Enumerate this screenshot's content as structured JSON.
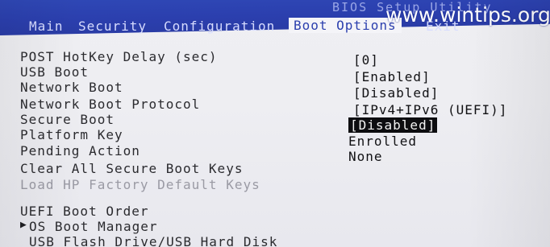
{
  "header": {
    "bios_title": "BIOS Setup Utility",
    "tabs": [
      {
        "label": "Main"
      },
      {
        "label": "Security"
      },
      {
        "label": "Configuration"
      },
      {
        "label": "Boot Options",
        "active": true
      },
      {
        "label": "Exit"
      }
    ],
    "watermark": "www.wintips.org"
  },
  "settings": [
    {
      "label": "POST HotKey Delay (sec)",
      "value": "[0]"
    },
    {
      "label": "USB Boot",
      "value": "[Enabled]"
    },
    {
      "label": "Network Boot",
      "value": "[Disabled]"
    },
    {
      "label": "Network Boot Protocol",
      "value": "[IPv4+IPv6 (UEFI)]"
    },
    {
      "label": "Secure Boot",
      "value": "[Disabled]",
      "selected": true
    },
    {
      "label": "Platform Key",
      "value": "Enrolled"
    },
    {
      "label": "Pending Action",
      "value": "None"
    },
    {
      "label": "Clear All Secure Boot Keys",
      "value": ""
    },
    {
      "label": "Load HP Factory Default Keys",
      "value": "",
      "disabled": true
    }
  ],
  "boot_order": {
    "title": "UEFI Boot Order",
    "items": [
      {
        "label": "OS Boot Manager",
        "marker": "▶"
      },
      {
        "label": "USB Flash Drive/USB Hard Disk"
      }
    ]
  },
  "colors": {
    "menubar": "#2b3fae",
    "background": "#eeeef2",
    "selected_bg": "#0d0d10",
    "selected_fg": "#f2f2f2"
  }
}
